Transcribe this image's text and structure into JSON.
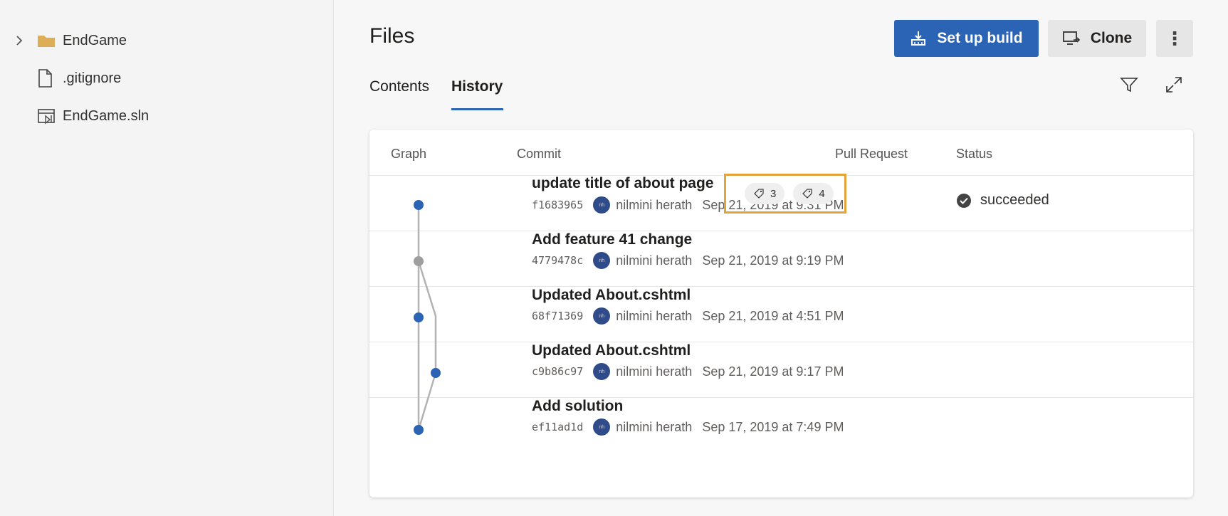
{
  "sidebar": {
    "items": [
      {
        "label": "EndGame",
        "icon": "folder-icon",
        "expander": "chevron-right-icon"
      },
      {
        "label": ".gitignore",
        "icon": "file-icon"
      },
      {
        "label": "EndGame.sln",
        "icon": "solution-file-icon"
      }
    ]
  },
  "header": {
    "title": "Files",
    "setup_build_label": "Set up build",
    "clone_label": "Clone",
    "more_label": "⋮"
  },
  "tabs": [
    {
      "label": "Contents",
      "selected": false
    },
    {
      "label": "History",
      "selected": true
    }
  ],
  "toolbar": {
    "filter_icon": "filter-icon",
    "expand_icon": "expand-icon"
  },
  "table": {
    "columns": [
      "Graph",
      "Commit",
      "Pull Request",
      "Status"
    ],
    "rows": [
      {
        "message": "update title of about page",
        "hash": "f1683965",
        "author": "nilmini herath",
        "date": "Sep 21, 2019 at 9:31 PM",
        "tags": [
          "3",
          "4"
        ],
        "status": "succeeded"
      },
      {
        "message": "Add feature 41 change",
        "hash": "4779478c",
        "author": "nilmini herath",
        "date": "Sep 21, 2019 at 9:19 PM"
      },
      {
        "message": "Updated About.cshtml",
        "hash": "68f71369",
        "author": "nilmini herath",
        "date": "Sep 21, 2019 at 4:51 PM"
      },
      {
        "message": "Updated About.cshtml",
        "hash": "c9b86c97",
        "author": "nilmini herath",
        "date": "Sep 21, 2019 at 9:17 PM"
      },
      {
        "message": "Add solution",
        "hash": "ef11ad1d",
        "author": "nilmini herath",
        "date": "Sep 17, 2019 at 7:49 PM"
      }
    ]
  },
  "colors": {
    "accent": "#2b63b5",
    "highlight": "#e2a33b",
    "graph_line": "#b3b3b3",
    "merge_node": "#9e9e9e"
  }
}
